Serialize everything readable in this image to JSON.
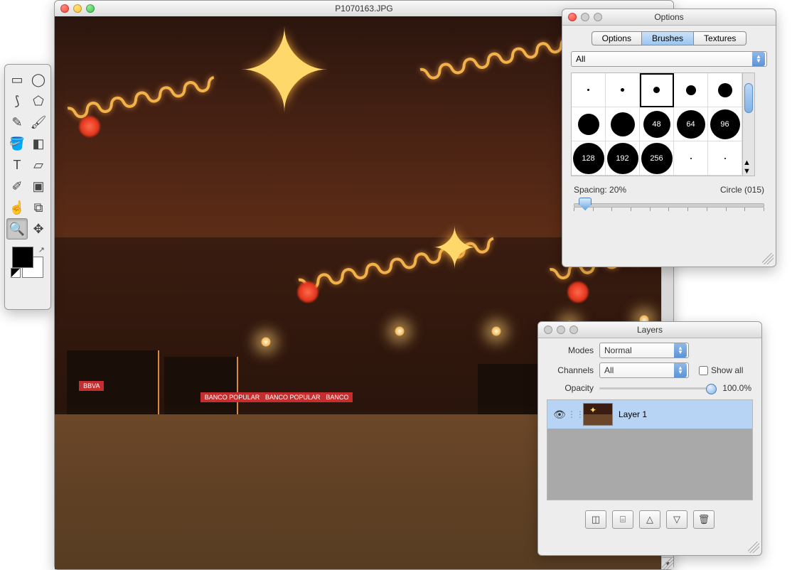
{
  "document": {
    "filename": "P1070163.JPG",
    "signs": [
      "BBVA",
      "BANCO POPULAR",
      "BANCO POPULAR",
      "BANCO"
    ]
  },
  "tools": {
    "items": [
      {
        "name": "rect-select",
        "glyph": "▭"
      },
      {
        "name": "ellipse-select",
        "glyph": "◯"
      },
      {
        "name": "lasso",
        "glyph": "⟆"
      },
      {
        "name": "polygon-lasso",
        "glyph": "⬠"
      },
      {
        "name": "pencil",
        "glyph": "✎"
      },
      {
        "name": "brush",
        "glyph": "🖌"
      },
      {
        "name": "paint-bucket",
        "glyph": "🪣"
      },
      {
        "name": "gradient",
        "glyph": "◧"
      },
      {
        "name": "text",
        "glyph": "T"
      },
      {
        "name": "eraser",
        "glyph": "▱"
      },
      {
        "name": "eyedropper",
        "glyph": "✐"
      },
      {
        "name": "crop",
        "glyph": "▣"
      },
      {
        "name": "smudge",
        "glyph": "☝"
      },
      {
        "name": "clone",
        "glyph": "⧉"
      },
      {
        "name": "zoom",
        "glyph": "🔍"
      },
      {
        "name": "move",
        "glyph": "✥"
      }
    ],
    "active_index": 14
  },
  "options_panel": {
    "title": "Options",
    "tabs": [
      "Options",
      "Brushes",
      "Textures"
    ],
    "active_tab": 1,
    "category": "All",
    "brushes": [
      {
        "size": 3,
        "label": ""
      },
      {
        "size": 5,
        "label": ""
      },
      {
        "size": 9,
        "label": "",
        "selected": true
      },
      {
        "size": 14,
        "label": ""
      },
      {
        "size": 20,
        "label": ""
      },
      {
        "size": 30,
        "label": ""
      },
      {
        "size": 34,
        "label": ""
      },
      {
        "size": 38,
        "label": "48"
      },
      {
        "size": 40,
        "label": "64"
      },
      {
        "size": 42,
        "label": "96"
      },
      {
        "size": 44,
        "label": "128"
      },
      {
        "size": 44,
        "label": "192"
      },
      {
        "size": 44,
        "label": "256"
      },
      {
        "size": 2,
        "label": ""
      },
      {
        "size": 2,
        "label": ""
      }
    ],
    "spacing_label": "Spacing: 20%",
    "brush_name": "Circle (015)"
  },
  "layers_panel": {
    "title": "Layers",
    "modes_label": "Modes",
    "modes_value": "Normal",
    "channels_label": "Channels",
    "channels_value": "All",
    "show_all_label": "Show all",
    "show_all_checked": false,
    "opacity_label": "Opacity",
    "opacity_value": "100.0%",
    "layers": [
      {
        "name": "Layer 1",
        "visible": true
      }
    ],
    "buttons": [
      {
        "name": "new-layer",
        "glyph": "◫"
      },
      {
        "name": "duplicate-layer",
        "glyph": "⌸"
      },
      {
        "name": "move-up",
        "glyph": "△"
      },
      {
        "name": "move-down",
        "glyph": "▽"
      },
      {
        "name": "delete-layer",
        "glyph": "🗑"
      }
    ]
  }
}
